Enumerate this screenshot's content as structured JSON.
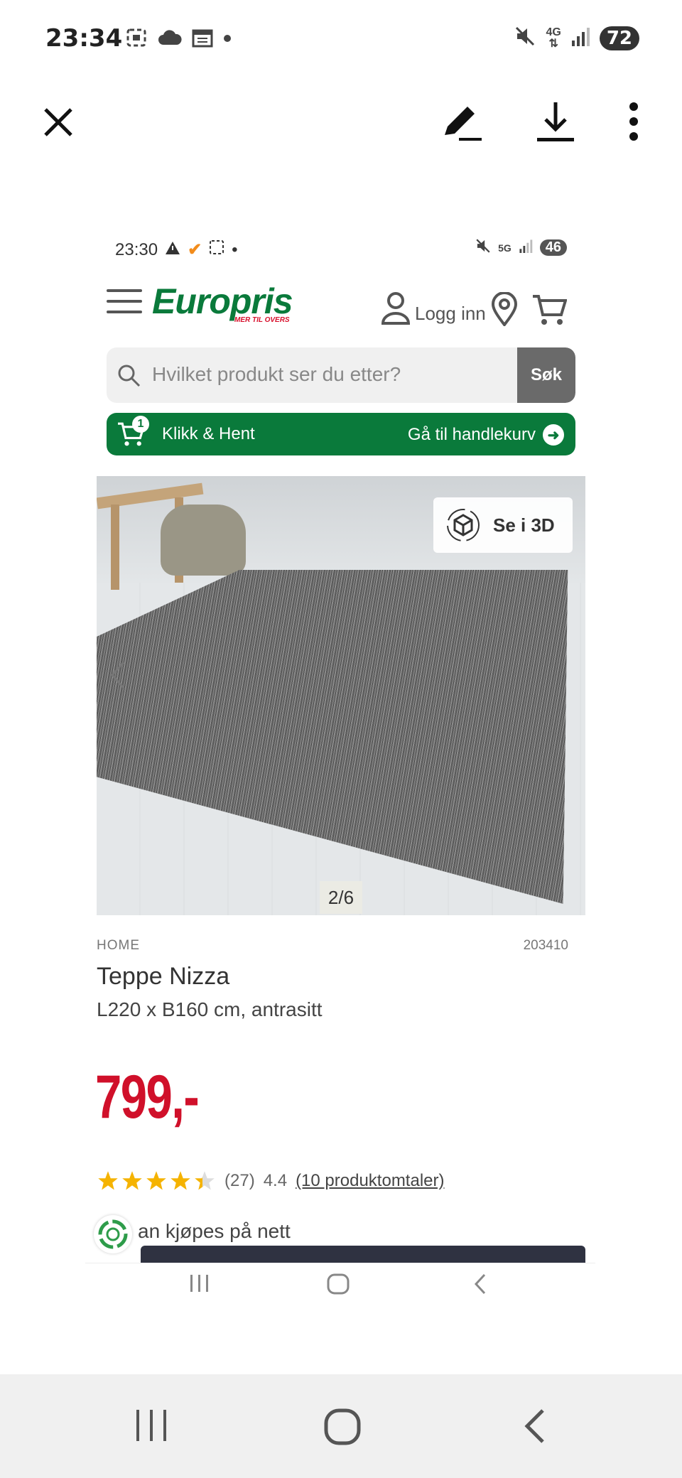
{
  "outer_status": {
    "time": "23:34",
    "network": "4G",
    "battery": "72",
    "icons_left": [
      "screenshot-icon",
      "cloud-icon",
      "calendar-icon",
      "dot-icon"
    ],
    "icons_right": [
      "mute-icon",
      "4g-icon",
      "signal-icon",
      "battery-icon"
    ]
  },
  "viewer_toolbar": {
    "close": "close-icon",
    "edit": "edit-icon",
    "download": "download-icon",
    "more": "more-icon"
  },
  "inner_status": {
    "time": "23:30",
    "network": "5G",
    "battery": "46"
  },
  "header": {
    "logo": "Europris",
    "logo_tagline": "MER TIL OVERS",
    "login_label": "Logg inn"
  },
  "search": {
    "placeholder": "Hvilket produkt ser du etter?",
    "button": "Søk"
  },
  "click_collect": {
    "badge": "1",
    "label": "Klikk & Hent",
    "cart_link": "Gå til handlekurv"
  },
  "gallery": {
    "view_3d": "Se i 3D",
    "counter": "2/6",
    "current": 2,
    "total": 6
  },
  "product": {
    "breadcrumb": "HOME",
    "sku": "203410",
    "title": "Teppe Nizza",
    "subtitle": "L220 x B160 cm, antrasitt",
    "price": "799,-",
    "rating_count": "(27)",
    "rating_value": "4.4",
    "rating_stars": 4.4,
    "reviews_link": "(10 produktomtaler)",
    "availability": "an kjøpes på nett"
  },
  "colors": {
    "brand_green": "#0a7a3b",
    "price_red": "#d0102a",
    "star": "#f5b301"
  }
}
